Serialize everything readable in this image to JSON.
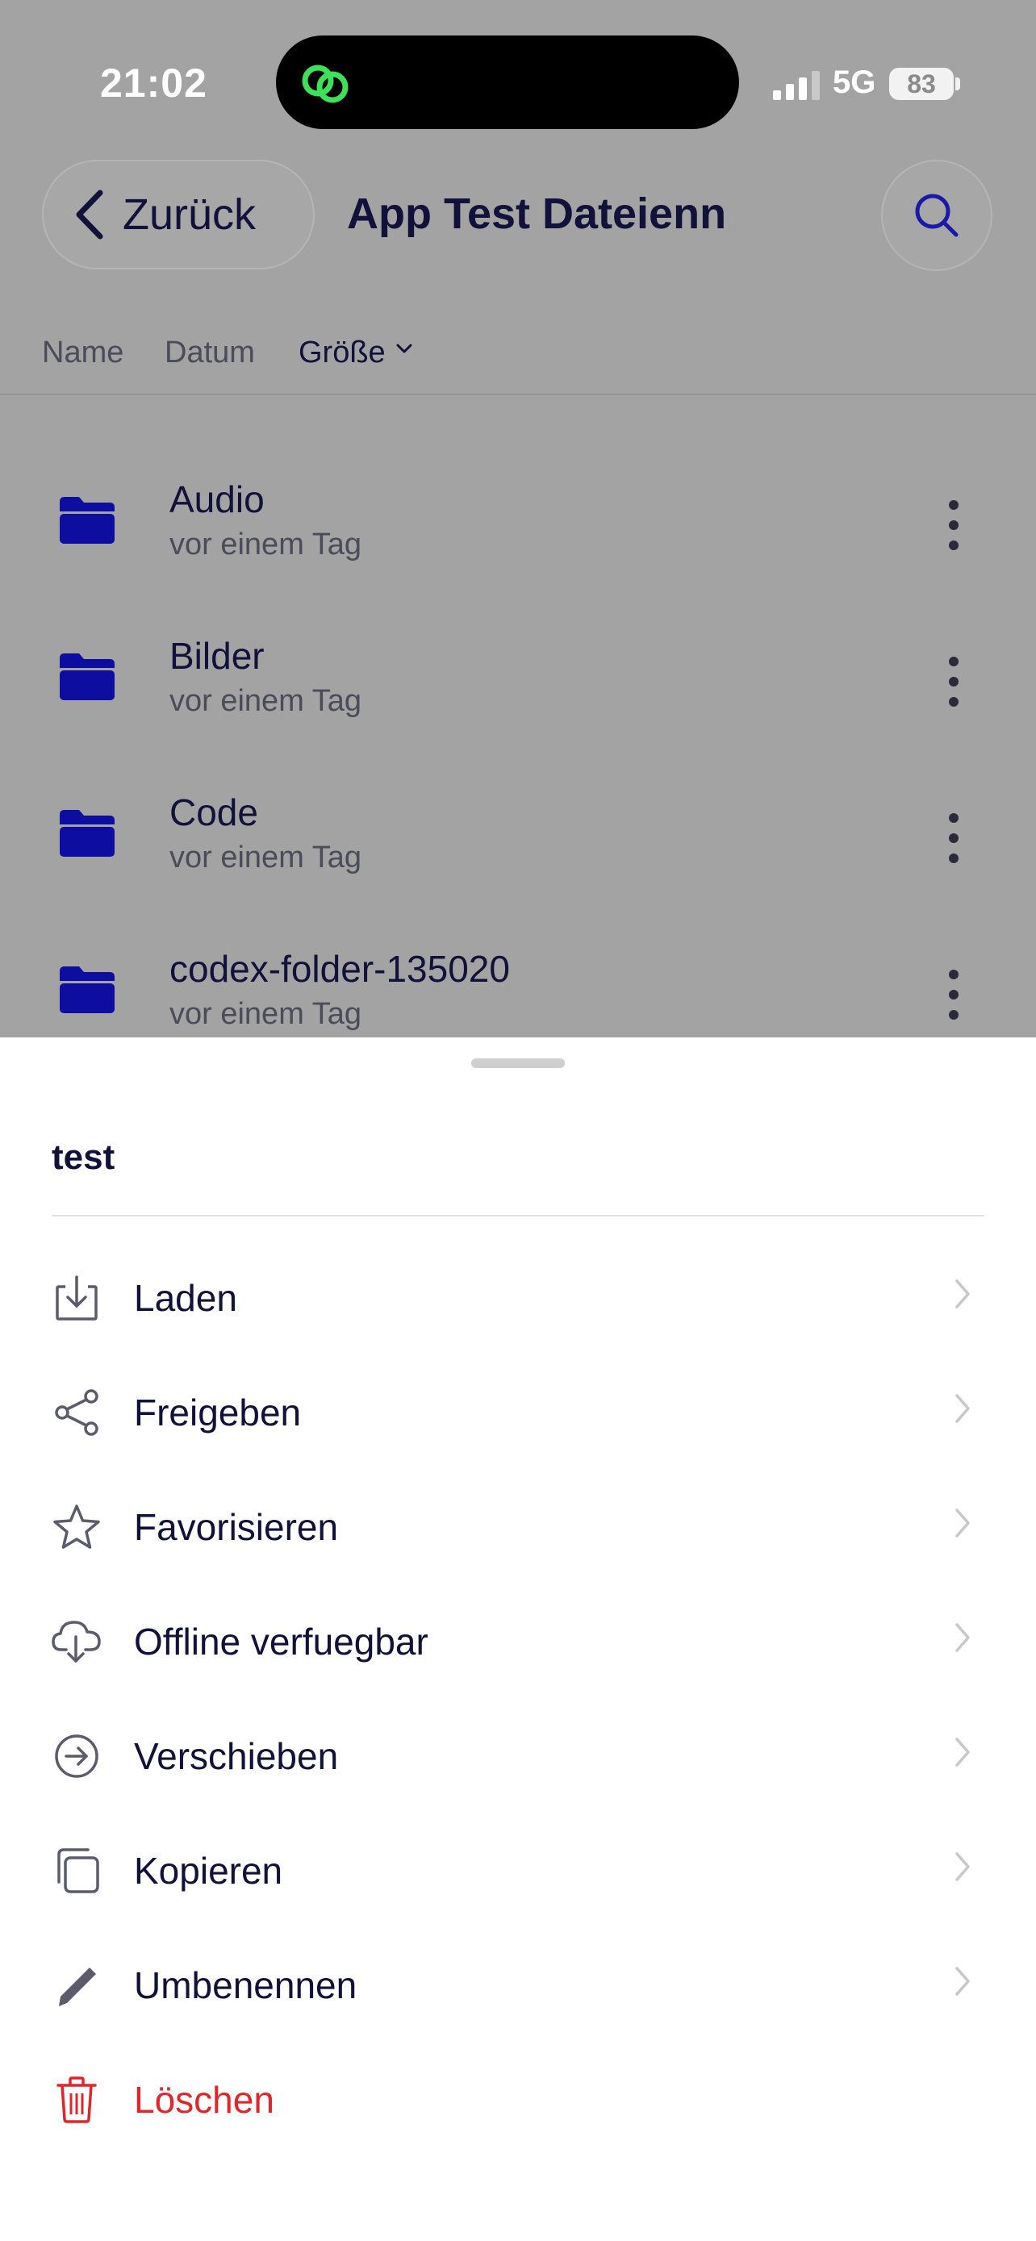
{
  "status_bar": {
    "time": "21:02",
    "network": "5G",
    "battery": "83"
  },
  "header": {
    "back_label": "Zurück",
    "title": "App Test Dateienn",
    "search_icon": "search-icon"
  },
  "sort_bar": {
    "options": [
      "Name",
      "Datum",
      "Größe"
    ],
    "active": "Größe"
  },
  "files": [
    {
      "name": "Audio",
      "modified": "vor einem Tag"
    },
    {
      "name": "Bilder",
      "modified": "vor einem Tag"
    },
    {
      "name": "Code",
      "modified": "vor einem Tag"
    },
    {
      "name": "codex-folder-135020",
      "modified": "vor einem Tag"
    }
  ],
  "sheet": {
    "title": "test",
    "actions": [
      {
        "label": "Laden",
        "icon": "download-icon"
      },
      {
        "label": "Freigeben",
        "icon": "share-icon"
      },
      {
        "label": "Favorisieren",
        "icon": "star-icon"
      },
      {
        "label": "Offline verfuegbar",
        "icon": "cloud-download-icon"
      },
      {
        "label": "Verschieben",
        "icon": "move-icon"
      },
      {
        "label": "Kopieren",
        "icon": "copy-icon"
      },
      {
        "label": "Umbenennen",
        "icon": "pencil-icon"
      },
      {
        "label": "Löschen",
        "icon": "trash-icon"
      }
    ]
  },
  "colors": {
    "accent": "#1a1aa6",
    "folder": "#0d0da0",
    "danger": "#e0262b",
    "text": "#11113a"
  }
}
